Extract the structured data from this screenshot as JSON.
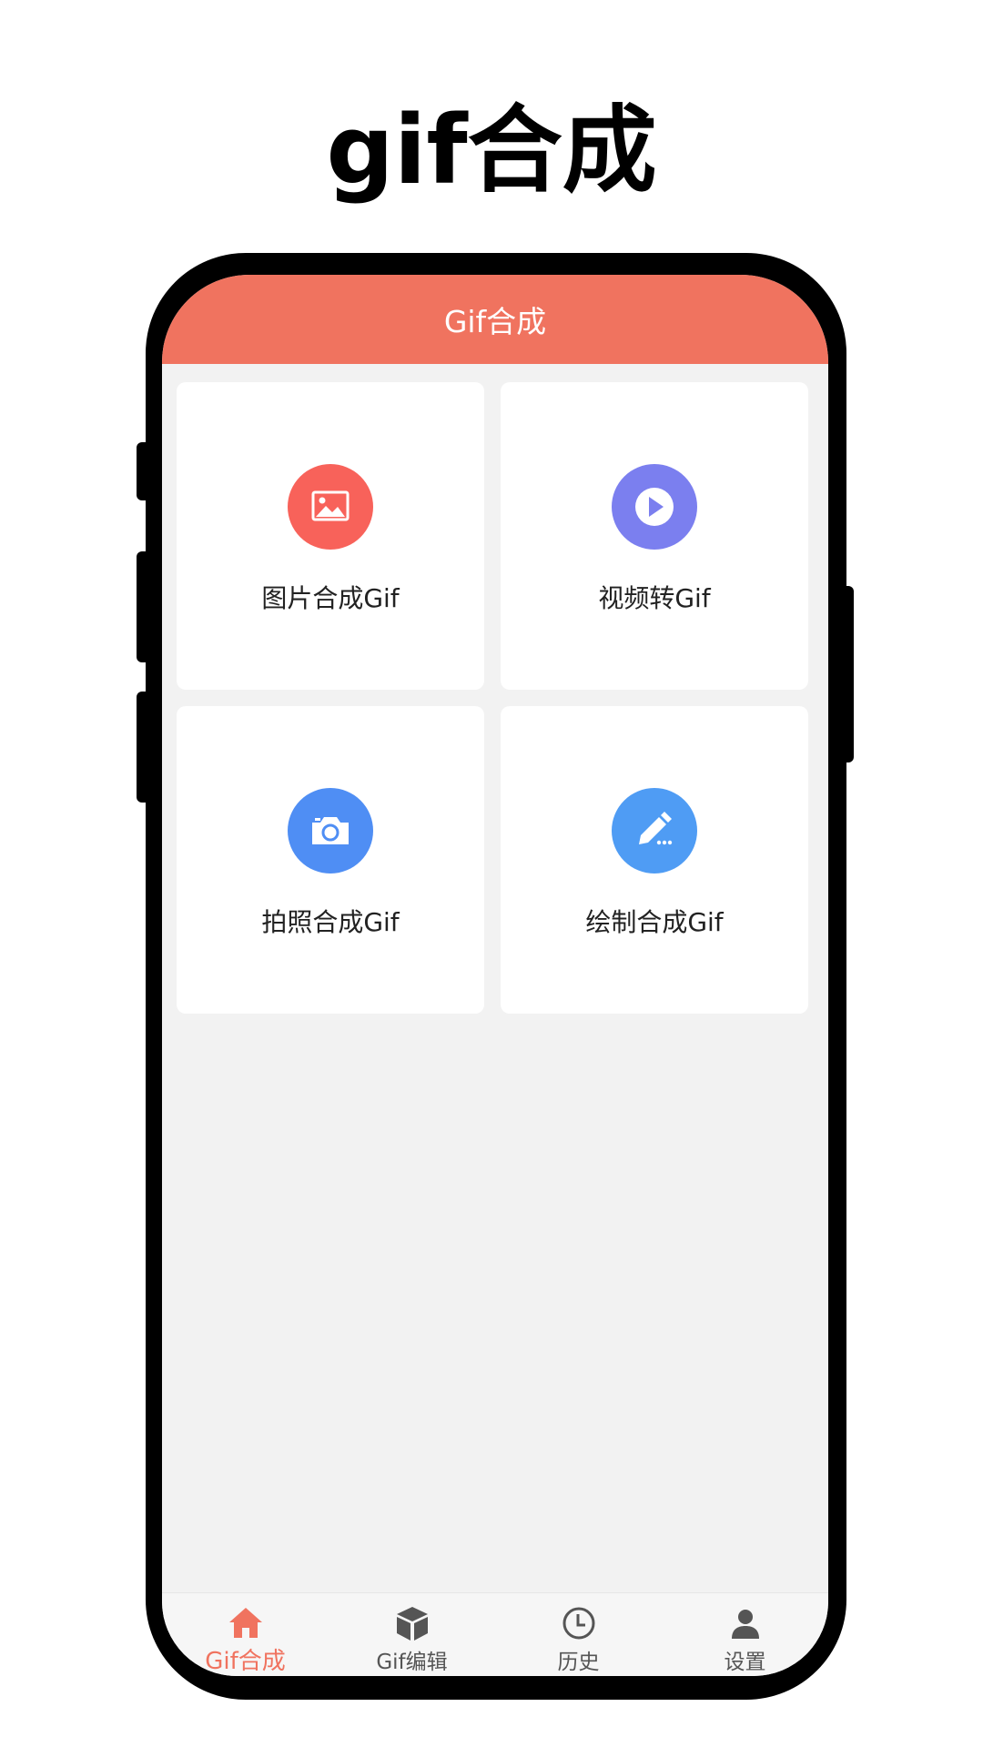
{
  "promo": {
    "title": "gif合成"
  },
  "app": {
    "header_title": "Gif合成",
    "accent_color": "#f0735f",
    "cards": [
      {
        "label": "图片合成Gif",
        "icon": "image-icon",
        "color": "#f8625a"
      },
      {
        "label": "视频转Gif",
        "icon": "play-icon",
        "color": "#7b7fef"
      },
      {
        "label": "拍照合成Gif",
        "icon": "camera-icon",
        "color": "#4f8ef4"
      },
      {
        "label": "绘制合成Gif",
        "icon": "pencil-icon",
        "color": "#4f9cf4"
      }
    ],
    "tabs": [
      {
        "label": "Gif合成",
        "icon": "home-icon",
        "active": true
      },
      {
        "label": "Gif编辑",
        "icon": "cube-icon",
        "active": false
      },
      {
        "label": "历史",
        "icon": "clock-icon",
        "active": false
      },
      {
        "label": "设置",
        "icon": "user-icon",
        "active": false
      }
    ]
  }
}
